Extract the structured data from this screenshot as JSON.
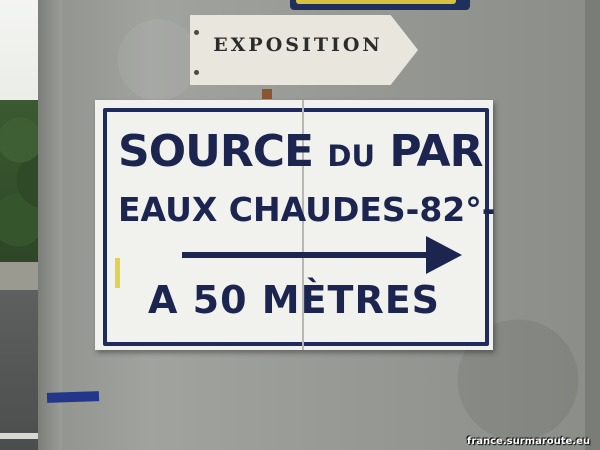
{
  "exposition_sign": {
    "text": "EXPOSITION"
  },
  "main_sign": {
    "line1_big_a": "SOURCE",
    "line1_small": "DU",
    "line1_big_b": "PAR",
    "line2": "EAUX CHAUDES-82°-",
    "line3": "A 50 MÈTRES"
  },
  "watermark": {
    "text": "france.surmaroute.eu"
  },
  "colors": {
    "sign_ink": "#1c2550",
    "sign_face": "#f1f2ee",
    "stone": "#979995"
  }
}
